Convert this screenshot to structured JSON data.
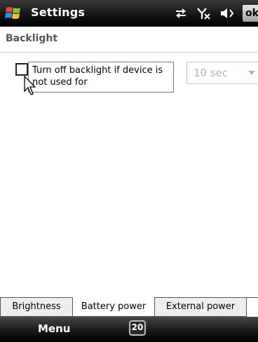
{
  "titlebar": {
    "title": "Settings",
    "ok_label": "ok",
    "icons": [
      "windows-start-icon",
      "connectivity-arrows-icon",
      "signal-off-icon",
      "speaker-volume-icon"
    ]
  },
  "section": {
    "title": "Backlight"
  },
  "backlight_option": {
    "checked": false,
    "label": "Turn off backlight if device is not used for",
    "timeout_value": "10 sec",
    "timeout_enabled": false
  },
  "tabs": [
    {
      "label": "Brightness",
      "active": false
    },
    {
      "label": "Battery power",
      "active": true
    },
    {
      "label": "External power",
      "active": false
    }
  ],
  "menubar": {
    "menu_label": "Menu",
    "input_panel_label": "20"
  }
}
